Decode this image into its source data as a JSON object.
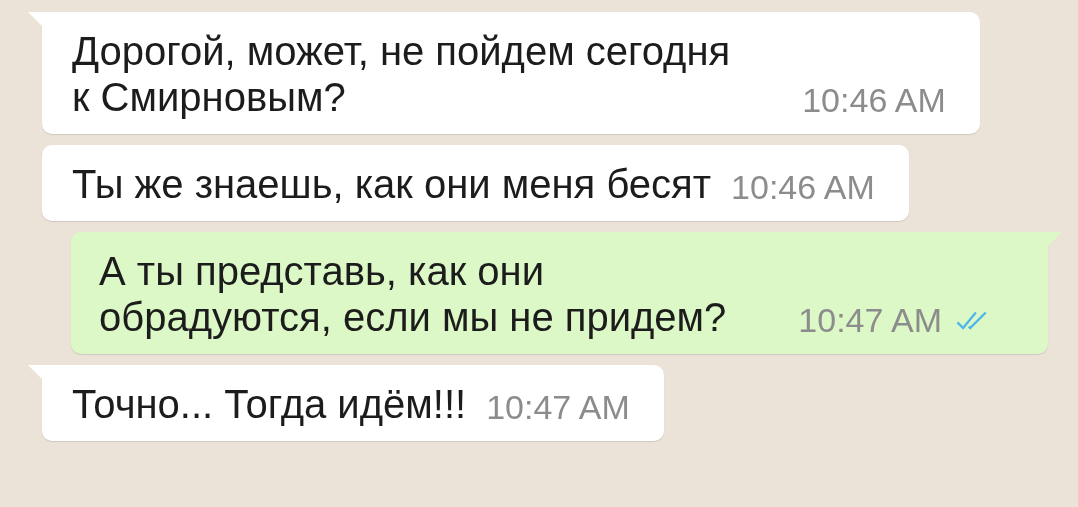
{
  "messages": [
    {
      "outgoing": false,
      "tail": true,
      "text": "Дорогой, может, не пойдем сегодня\nк Смирновым?",
      "time": "10:46 AM"
    },
    {
      "outgoing": false,
      "tail": false,
      "text": "Ты же знаешь, как они меня бесят",
      "time": "10:46 AM"
    },
    {
      "outgoing": true,
      "tail": true,
      "text": "А ты представь, как они\nобрадуются, если мы не придем?",
      "time": "10:47 AM",
      "read": true
    },
    {
      "outgoing": false,
      "tail": true,
      "text": "Точно... Тогда идём!!!",
      "time": "10:47 AM"
    }
  ]
}
